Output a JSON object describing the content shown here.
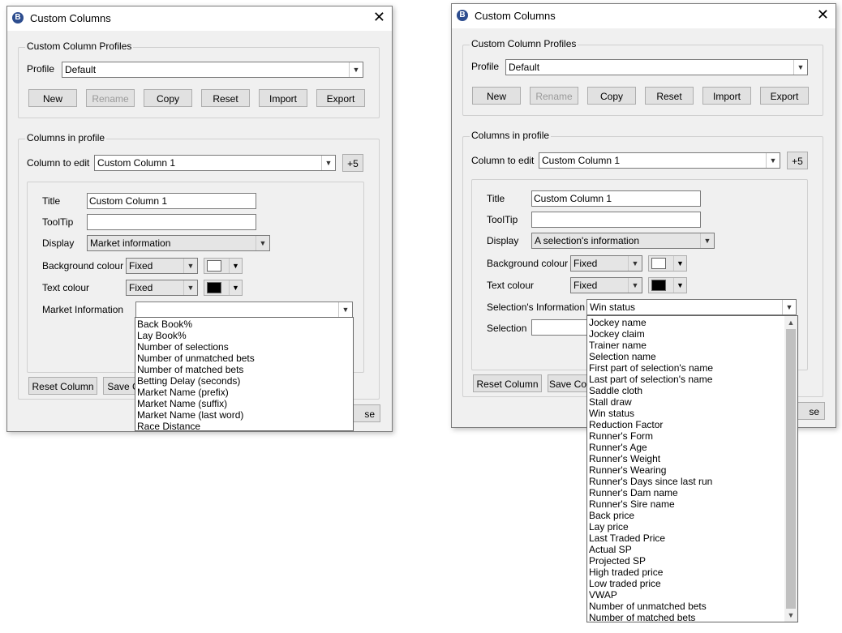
{
  "left": {
    "title": "Custom Columns",
    "profiles_group": "Custom Column Profiles",
    "profile_label": "Profile",
    "profile_value": "Default",
    "buttons": {
      "new": "New",
      "rename": "Rename",
      "copy": "Copy",
      "reset": "Reset",
      "import": "Import",
      "export": "Export"
    },
    "columns_group": "Columns in profile",
    "column_to_edit_label": "Column to edit",
    "column_to_edit_value": "Custom Column 1",
    "plus_button": "+5",
    "title_label": "Title",
    "title_value": "Custom Column 1",
    "tooltip_label": "ToolTip",
    "tooltip_value": "",
    "display_label": "Display",
    "display_value": "Market information",
    "bg_label": "Background colour",
    "bg_mode": "Fixed",
    "bg_color": "#ffffff",
    "text_color_label": "Text colour",
    "text_mode": "Fixed",
    "text_color": "#000000",
    "info_label": "Market Information",
    "info_value": "",
    "reset_column": "Reset Column",
    "save_partial": "Save C",
    "close_partial": "se",
    "dropdown": [
      "Back Book%",
      "Lay Book%",
      "Number of selections",
      "Number of unmatched bets",
      "Number of matched bets",
      "Betting Delay (seconds)",
      "Market Name (prefix)",
      "Market Name (suffix)",
      "Market Name (last word)",
      "Race Distance"
    ]
  },
  "right": {
    "title": "Custom Columns",
    "profiles_group": "Custom Column Profiles",
    "profile_label": "Profile",
    "profile_value": "Default",
    "buttons": {
      "new": "New",
      "rename": "Rename",
      "copy": "Copy",
      "reset": "Reset",
      "import": "Import",
      "export": "Export"
    },
    "columns_group": "Columns in profile",
    "column_to_edit_label": "Column to edit",
    "column_to_edit_value": "Custom Column 1",
    "plus_button": "+5",
    "title_label": "Title",
    "title_value": "Custom Column 1",
    "tooltip_label": "ToolTip",
    "tooltip_value": "",
    "display_label": "Display",
    "display_value": "A selection's information",
    "bg_label": "Background colour",
    "bg_mode": "Fixed",
    "bg_color": "#ffffff",
    "text_color_label": "Text colour",
    "text_mode": "Fixed",
    "text_color": "#000000",
    "info_label": "Selection's Information",
    "info_value": "Win status",
    "selection_label": "Selection",
    "reset_column": "Reset Column",
    "save_partial": "Save Co",
    "close_partial": "se",
    "dropdown": [
      "Jockey name",
      "Jockey claim",
      "Trainer name",
      "Selection name",
      "First part of selection's name",
      "Last part of selection's name",
      "Saddle cloth",
      "Stall draw",
      "Win status",
      "Reduction Factor",
      "Runner's Form",
      "Runner's Age",
      "Runner's Weight",
      "Runner's Wearing",
      "Runner's Days since last run",
      "Runner's Dam name",
      "Runner's Sire name",
      "Back price",
      "Lay price",
      "Last Traded Price",
      "Actual SP",
      "Projected SP",
      "High traded price",
      "Low traded price",
      "VWAP",
      "Number of unmatched bets",
      "Number of matched bets"
    ]
  },
  "icons": {
    "app": "app-logo-icon",
    "close": "close-icon",
    "arrow": "chevron-down-icon"
  }
}
